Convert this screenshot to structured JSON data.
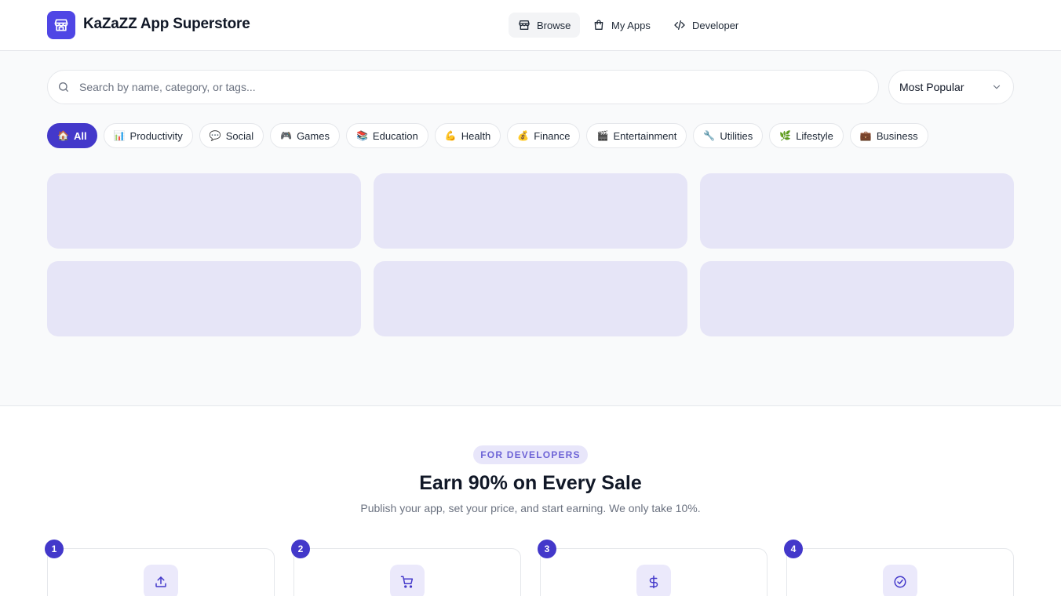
{
  "header": {
    "brand": "KaZaZZ App Superstore",
    "nav": [
      {
        "label": "Browse",
        "icon": "store-icon",
        "active": true
      },
      {
        "label": "My Apps",
        "icon": "shopping-bag-icon",
        "active": false
      },
      {
        "label": "Developer",
        "icon": "code-icon",
        "active": false
      }
    ]
  },
  "search": {
    "placeholder": "Search by name, category, or tags...",
    "value": ""
  },
  "sort": {
    "selected": "Most Popular"
  },
  "categories": [
    {
      "emoji": "🏠",
      "label": "All",
      "active": true
    },
    {
      "emoji": "📊",
      "label": "Productivity"
    },
    {
      "emoji": "💬",
      "label": "Social"
    },
    {
      "emoji": "🎮",
      "label": "Games"
    },
    {
      "emoji": "📚",
      "label": "Education"
    },
    {
      "emoji": "💪",
      "label": "Health"
    },
    {
      "emoji": "💰",
      "label": "Finance"
    },
    {
      "emoji": "🎬",
      "label": "Entertainment"
    },
    {
      "emoji": "🔧",
      "label": "Utilities"
    },
    {
      "emoji": "🌿",
      "label": "Lifestyle"
    },
    {
      "emoji": "💼",
      "label": "Business"
    }
  ],
  "developers": {
    "badge": "FOR DEVELOPERS",
    "title": "Earn 90% on Every Sale",
    "subtitle": "Publish your app, set your price, and start earning. We only take 10%.",
    "steps": [
      {
        "number": "1",
        "icon": "upload-icon"
      },
      {
        "number": "2",
        "icon": "cart-icon"
      },
      {
        "number": "3",
        "icon": "dollar-icon"
      },
      {
        "number": "4",
        "icon": "check-circle-icon"
      }
    ]
  },
  "colors": {
    "accent": "#4338ca",
    "logo": "#4f46e5",
    "skeleton": "#e6e5f7",
    "background": "#f9fafb"
  }
}
